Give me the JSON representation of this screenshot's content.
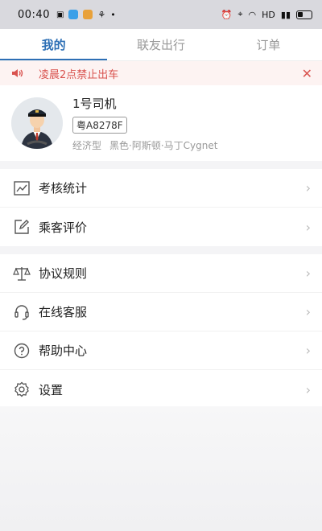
{
  "status_bar": {
    "time": "00:40",
    "right_text": "HD"
  },
  "tabs": [
    {
      "label": "我的",
      "active": true
    },
    {
      "label": "联友出行",
      "active": false
    },
    {
      "label": "订单",
      "active": false
    }
  ],
  "notice": {
    "text": "凌晨2点禁止出车",
    "icon": "speaker-icon",
    "close_icon": "close-icon"
  },
  "profile": {
    "name": "1号司机",
    "plate": "粤A8278F",
    "car_class": "经济型",
    "car_desc": "黑色·阿斯顿·马丁Cygnet",
    "avatar_icon": "driver-avatar"
  },
  "menu_groups": [
    {
      "items": [
        {
          "label": "考核统计",
          "icon": "chart-icon"
        },
        {
          "label": "乘客评价",
          "icon": "edit-icon"
        }
      ]
    },
    {
      "items": [
        {
          "label": "协议规则",
          "icon": "scale-icon"
        },
        {
          "label": "在线客服",
          "icon": "headset-icon"
        },
        {
          "label": "帮助中心",
          "icon": "help-icon"
        },
        {
          "label": "设置",
          "icon": "gear-icon"
        }
      ]
    }
  ],
  "colors": {
    "accent": "#2d6fb5",
    "notice": "#d9534f"
  }
}
